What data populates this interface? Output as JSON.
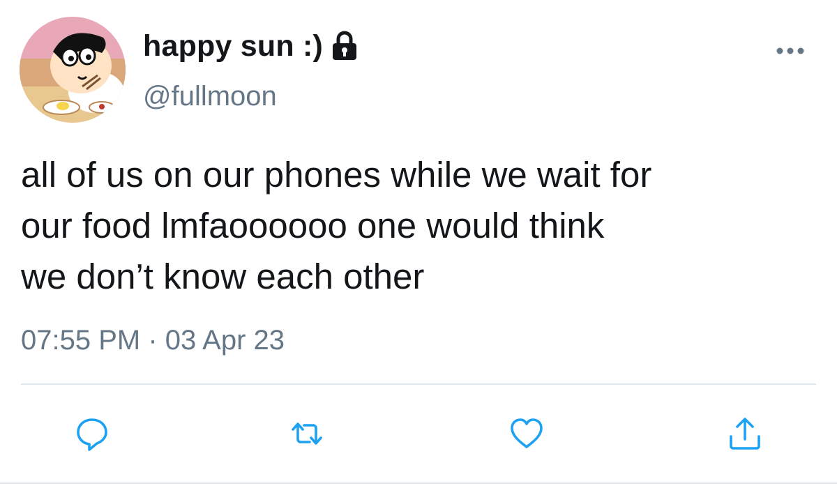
{
  "tweet": {
    "display_name": "happy sun :)",
    "handle": "@fullmoon",
    "text_lines": [
      "all of us on our phones while we wait for",
      "our food lmfaoooooo one would think",
      "we don’t know each other"
    ],
    "timestamp": "07:55 PM · 03 Apr 23"
  },
  "icons": {
    "avatar": "avatar-image",
    "verified_or_protected": "lock-icon",
    "more": "more-horizontal-icon",
    "reply": "reply-icon",
    "retweet": "retweet-icon",
    "like": "heart-icon",
    "share": "share-icon"
  },
  "colors": {
    "text": "#14171a",
    "secondary_text": "#657786",
    "action_icon": "#1da1f2",
    "divider": "#e1e8ed"
  }
}
